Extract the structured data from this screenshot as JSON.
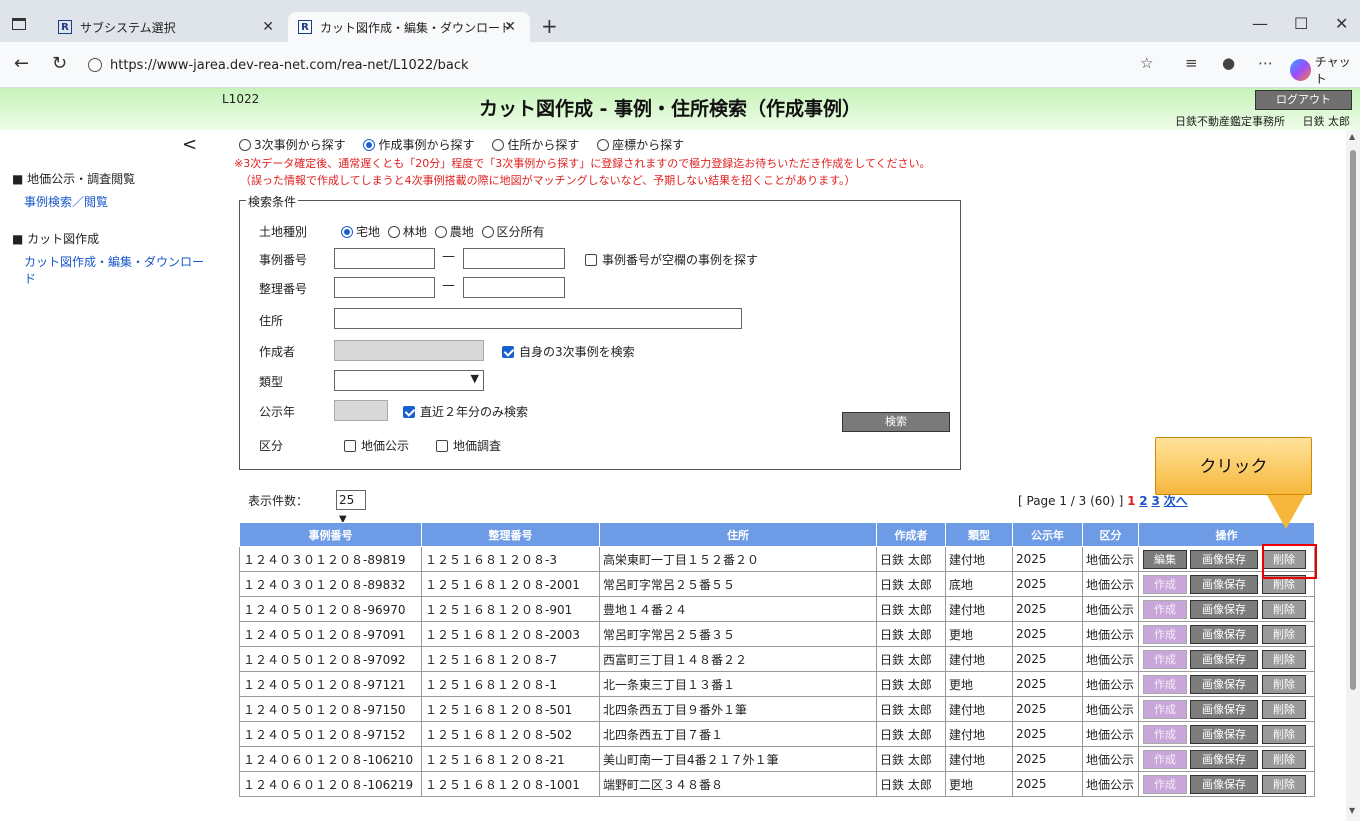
{
  "browser": {
    "tabs": [
      {
        "label": "サブシステム選択",
        "favicon": "R"
      },
      {
        "label": "カット図作成・編集・ダウンロード",
        "favicon": "R"
      }
    ],
    "url": "https://www-jarea.dev-rea-net.com/rea-net/L1022/back",
    "chat_label": "チャット"
  },
  "header": {
    "screen_id": "L1022",
    "title": "カット図作成 - 事例・住所検索（作成事例）",
    "logout": "ログアウト",
    "office": "日鉄不動産鑑定事務所",
    "user": "日鉄 太郎"
  },
  "sidebar": {
    "collapse": "<",
    "sections": [
      {
        "heading": "■ 地価公示・調査閲覧",
        "link": "事例検索／閲覧"
      },
      {
        "heading": "■ カット図作成",
        "link": "カット図作成・編集・ダウンロード"
      }
    ]
  },
  "search_modes": [
    "3次事例から探す",
    "作成事例から探す",
    "住所から探す",
    "座標から探す"
  ],
  "warnings": [
    "※3次データ確定後、通常遅くとも「20分」程度で「3次事例から探す」に登録されますので極力登録迄お待ちいただき作成をしてください。",
    "（誤った情報で作成してしまうと4次事例搭載の際に地図がマッチングしないなど、予期しない結果を招くことがあります。）"
  ],
  "conditions": {
    "legend": "検索条件",
    "land_type_label": "土地種別",
    "land_types": [
      "宅地",
      "林地",
      "農地",
      "区分所有"
    ],
    "case_no_label": "事例番号",
    "case_empty_label": "事例番号が空欄の事例を探す",
    "ref_no_label": "整理番号",
    "address_label": "住所",
    "creator_label": "作成者",
    "creator_self_label": "自身の3次事例を検索",
    "type_label": "類型",
    "year_label": "公示年",
    "year_recent_label": "直近２年分のみ検索",
    "division_label": "区分",
    "division_opts": [
      "地価公示",
      "地価調査"
    ],
    "search_button": "検索"
  },
  "listing": {
    "per_page_label": "表示件数：",
    "per_page_value": "25",
    "pager_text": "[ Page 1 / 3 (60) ]",
    "pages": [
      "1",
      "2",
      "3",
      "次へ"
    ]
  },
  "table": {
    "headers": [
      "事例番号",
      "整理番号",
      "住所",
      "作成者",
      "類型",
      "公示年",
      "区分",
      "操作"
    ],
    "buttons": {
      "edit": "編集",
      "create": "作成",
      "save": "画像保存",
      "delete": "削除"
    },
    "rows": [
      {
        "case": "１２４０３０１２０８-89819",
        "ref": "１２５１６８１２０８-3",
        "addr": "高栄東町一丁目１５２番２０",
        "creator": "日鉄 太郎",
        "type": "建付地",
        "year": "2025",
        "div": "地価公示",
        "op": "edit"
      },
      {
        "case": "１２４０３０１２０８-89832",
        "ref": "１２５１６８１２０８-2001",
        "addr": "常呂町字常呂２５番５５",
        "creator": "日鉄 太郎",
        "type": "底地",
        "year": "2025",
        "div": "地価公示",
        "op": "create"
      },
      {
        "case": "１２４０５０１２０８-96970",
        "ref": "１２５１６８１２０８-901",
        "addr": "豊地１４番２４",
        "creator": "日鉄 太郎",
        "type": "建付地",
        "year": "2025",
        "div": "地価公示",
        "op": "create"
      },
      {
        "case": "１２４０５０１２０８-97091",
        "ref": "１２５１６８１２０８-2003",
        "addr": "常呂町字常呂２５番３５",
        "creator": "日鉄 太郎",
        "type": "更地",
        "year": "2025",
        "div": "地価公示",
        "op": "create"
      },
      {
        "case": "１２４０５０１２０８-97092",
        "ref": "１２５１６８１２０８-7",
        "addr": "西富町三丁目１４８番２２",
        "creator": "日鉄 太郎",
        "type": "建付地",
        "year": "2025",
        "div": "地価公示",
        "op": "create"
      },
      {
        "case": "１２４０５０１２０８-97121",
        "ref": "１２５１６８１２０８-1",
        "addr": "北一条東三丁目１３番１",
        "creator": "日鉄 太郎",
        "type": "更地",
        "year": "2025",
        "div": "地価公示",
        "op": "create"
      },
      {
        "case": "１２４０５０１２０８-97150",
        "ref": "１２５１６８１２０８-501",
        "addr": "北四条西五丁目９番外１筆",
        "creator": "日鉄 太郎",
        "type": "建付地",
        "year": "2025",
        "div": "地価公示",
        "op": "create"
      },
      {
        "case": "１２４０５０１２０８-97152",
        "ref": "１２５１６８１２０８-502",
        "addr": "北四条西五丁目７番１",
        "creator": "日鉄 太郎",
        "type": "建付地",
        "year": "2025",
        "div": "地価公示",
        "op": "create"
      },
      {
        "case": "１２４０６０１２０８-106210",
        "ref": "１２５１６８１２０８-21",
        "addr": "美山町南一丁目4番２１７外１筆",
        "creator": "日鉄 太郎",
        "type": "建付地",
        "year": "2025",
        "div": "地価公示",
        "op": "create"
      },
      {
        "case": "１２４０６０１２０８-106219",
        "ref": "１２５１６８１２０８-1001",
        "addr": "端野町二区３４８番８",
        "creator": "日鉄 太郎",
        "type": "更地",
        "year": "2025",
        "div": "地価公示",
        "op": "create"
      }
    ]
  },
  "callout": {
    "text": "クリック"
  }
}
